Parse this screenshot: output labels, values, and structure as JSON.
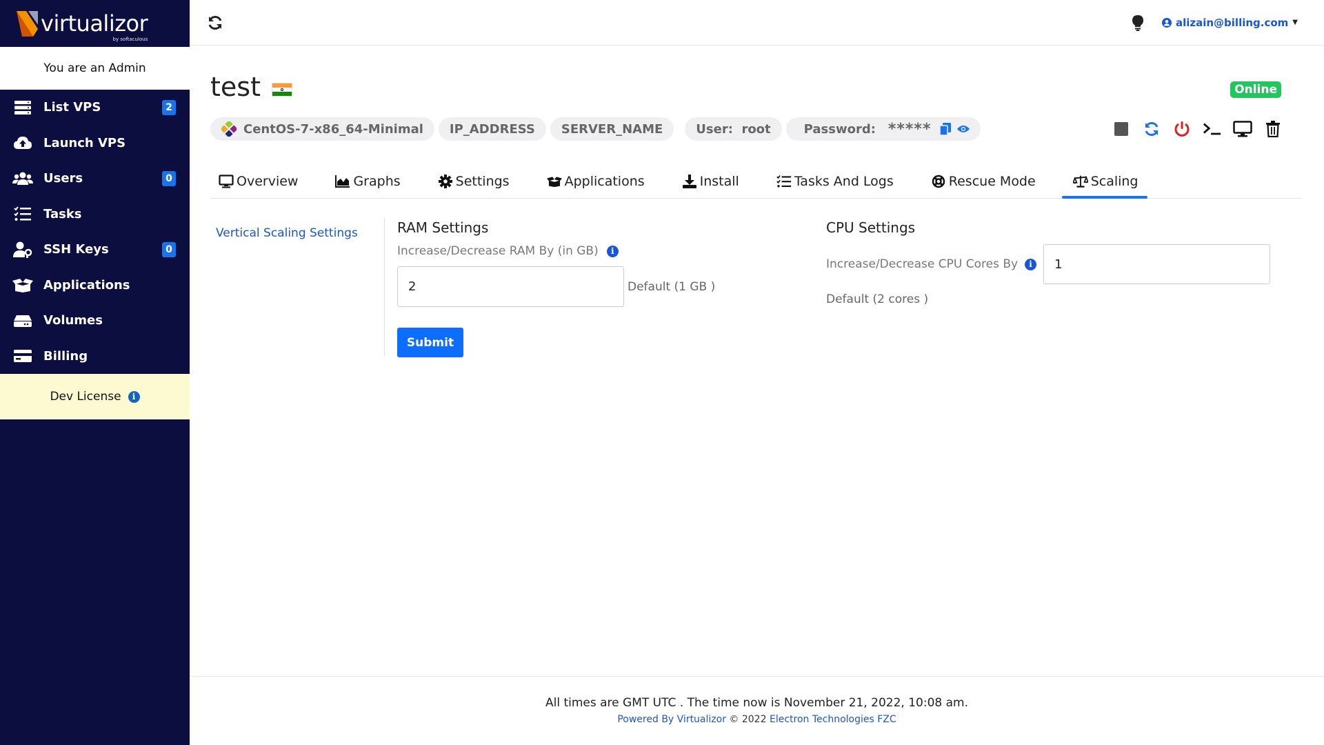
{
  "brand": {
    "name": "virtualizor",
    "sub": "by softaculous"
  },
  "sidebar": {
    "admin_label": "You are an Admin",
    "items": [
      {
        "label": "List VPS",
        "badge": "2",
        "icon": "server-icon"
      },
      {
        "label": "Launch VPS",
        "badge": "",
        "icon": "cloud-upload-icon"
      },
      {
        "label": "Users",
        "badge": "0",
        "icon": "users-icon"
      },
      {
        "label": "Tasks",
        "badge": "",
        "icon": "tasks-icon"
      },
      {
        "label": "SSH Keys",
        "badge": "0",
        "icon": "user-key-icon"
      },
      {
        "label": "Applications",
        "badge": "",
        "icon": "box-open-icon"
      },
      {
        "label": "Volumes",
        "badge": "",
        "icon": "hdd-icon"
      },
      {
        "label": "Billing",
        "badge": "",
        "icon": "credit-card-icon"
      }
    ],
    "dev_license": "Dev License"
  },
  "topbar": {
    "user_email": "alizain@billing.com"
  },
  "vps": {
    "name": "test",
    "status": "Online",
    "os": "CentOS-7-x86_64-Minimal",
    "ip": "IP_ADDRESS",
    "server": "SERVER_NAME",
    "user": "User:  root",
    "password_label": "Password:",
    "password_mask": "*****"
  },
  "tabs": [
    {
      "label": "Overview"
    },
    {
      "label": "Graphs"
    },
    {
      "label": "Settings"
    },
    {
      "label": "Applications"
    },
    {
      "label": "Install"
    },
    {
      "label": "Tasks And Logs"
    },
    {
      "label": "Rescue Mode"
    },
    {
      "label": "Scaling"
    }
  ],
  "scaling": {
    "side_link": "Vertical Scaling Settings",
    "ram": {
      "title": "RAM Settings",
      "label": "Increase/Decrease RAM By (in GB)",
      "value": "2",
      "default": "Default (1 GB )",
      "submit": "Submit"
    },
    "cpu": {
      "title": "CPU Settings",
      "label": "Increase/Decrease CPU Cores By",
      "value": "1",
      "default": "Default (2 cores )"
    }
  },
  "footer": {
    "time": "All times are GMT UTC . The time now is November 21, 2022, 10:08 am.",
    "powered": "Powered By Virtualizor",
    "copyright": "© 2022",
    "company": "Electron Technologies FZC"
  },
  "colors": {
    "sidebar_bg": "#0b0e3f",
    "accent": "#1a73e8",
    "online": "#22c55e",
    "dev_license_bg": "#fdfad1"
  }
}
